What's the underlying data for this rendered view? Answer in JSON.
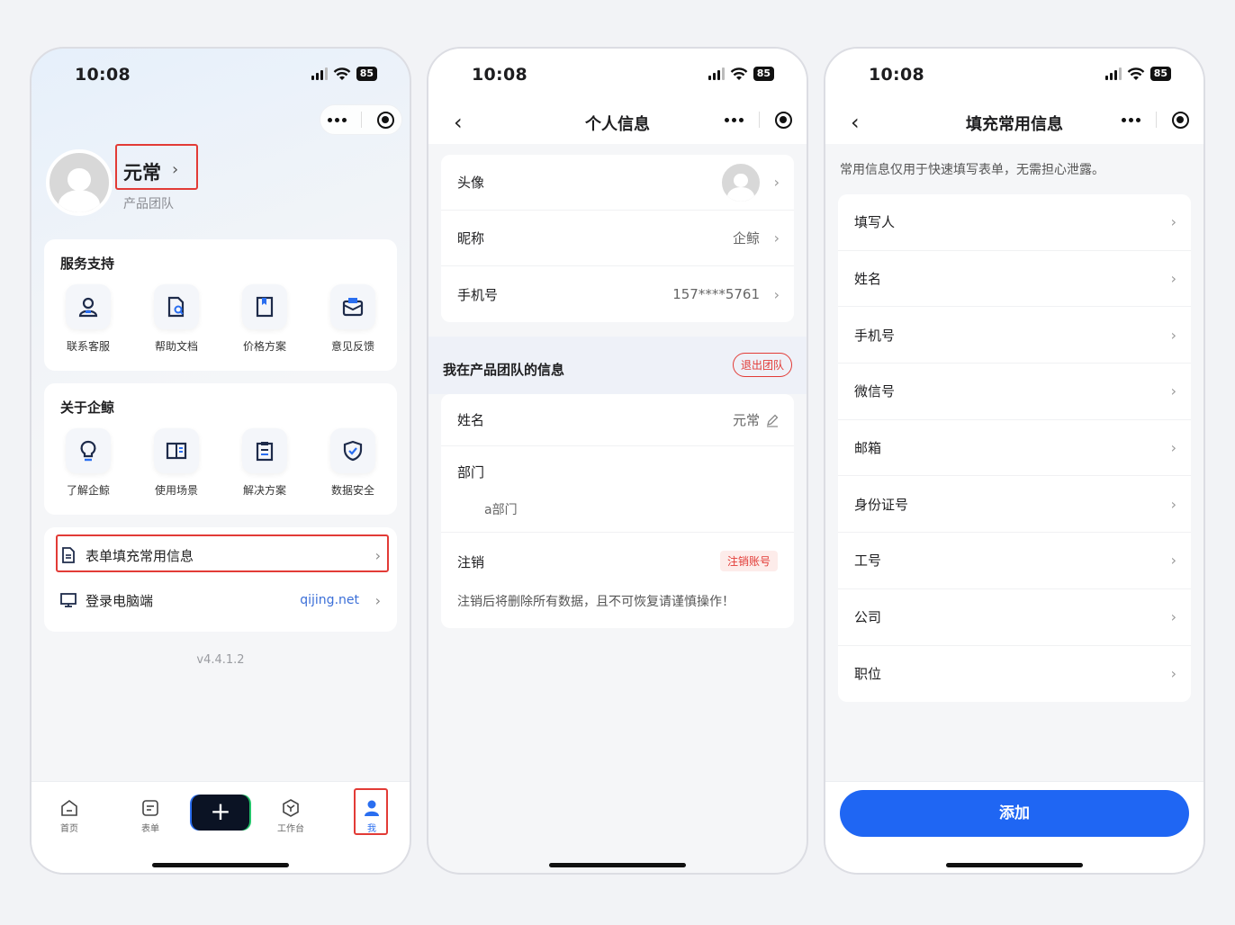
{
  "status": {
    "time": "10:08",
    "battery": "85"
  },
  "profile": {
    "name": "元常",
    "team": "产品团队",
    "services_title": "服务支持",
    "services": [
      {
        "label": "联系客服",
        "icon": "customer-service-icon"
      },
      {
        "label": "帮助文档",
        "icon": "help-doc-icon"
      },
      {
        "label": "价格方案",
        "icon": "price-plan-icon"
      },
      {
        "label": "意见反馈",
        "icon": "feedback-icon"
      }
    ],
    "about_title": "关于企鲸",
    "about": [
      {
        "label": "了解企鲸",
        "icon": "lightbulb-icon"
      },
      {
        "label": "使用场景",
        "icon": "book-icon"
      },
      {
        "label": "解决方案",
        "icon": "clipboard-icon"
      },
      {
        "label": "数据安全",
        "icon": "shield-check-icon"
      }
    ],
    "links": [
      {
        "label": "表单填充常用信息",
        "value": ""
      },
      {
        "label": "登录电脑端",
        "value": "qijing.net"
      }
    ],
    "version": "v4.4.1.2",
    "tabs": [
      "首页",
      "表单",
      "工作台",
      "我"
    ],
    "plus": "+"
  },
  "personal": {
    "title": "个人信息",
    "rows": [
      {
        "label": "头像",
        "value": ""
      },
      {
        "label": "昵称",
        "value": "企鲸"
      },
      {
        "label": "手机号",
        "value": "157****5761"
      }
    ],
    "team_section": "我在产品团队的信息",
    "quit": "退出团队",
    "name_label": "姓名",
    "name_value": "元常",
    "dept_label": "部门",
    "dept_value": "a部门",
    "cancel_label": "注销",
    "cancel_btn": "注销账号",
    "cancel_note": "注销后将删除所有数据，且不可恢复请谨慎操作！"
  },
  "fill": {
    "title": "填充常用信息",
    "note": "常用信息仅用于快速填写表单，无需担心泄露。",
    "rows": [
      "填写人",
      "姓名",
      "手机号",
      "微信号",
      "邮箱",
      "身份证号",
      "工号",
      "公司",
      "职位"
    ],
    "add": "添加"
  },
  "colors": {
    "accent": "#1f66f3",
    "danger": "#e23b36",
    "highlight_box": "#e23b36"
  }
}
